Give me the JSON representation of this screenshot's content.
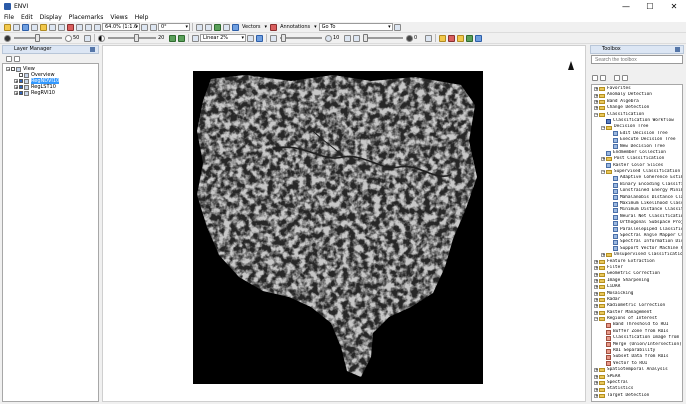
{
  "window": {
    "title": "ENVI",
    "minimize": "—",
    "maximize": "☐",
    "close": "✕"
  },
  "menu": [
    "File",
    "Edit",
    "Display",
    "Placemarks",
    "Views",
    "Help"
  ],
  "toolbar": {
    "zoom_value": "64.0% (1:1.6",
    "rotation_value": "0°",
    "vectors_label": "Vectors",
    "annotations_label": "Annotations",
    "goto_value": "Go To",
    "brightness_value": "50",
    "contrast_value": "20",
    "stretch_value": "Linear 2%",
    "sharpen_value": "10",
    "transparency_value": "0",
    "brightness_level": 0.5,
    "contrast_level": 0.6,
    "sharpen_level": 0.1,
    "transparency_level": 0.0
  },
  "layer_manager": {
    "title": "Layer Manager",
    "items": [
      {
        "label": "View",
        "depth": 0,
        "expander": "−",
        "checkbox": false,
        "selected": false
      },
      {
        "label": "Overview",
        "depth": 1,
        "expander": "",
        "checkbox": false,
        "selected": false
      },
      {
        "label": "RegNDVI10",
        "depth": 1,
        "expander": "+",
        "checkbox": true,
        "selected": true
      },
      {
        "label": "RegLST10",
        "depth": 1,
        "expander": "+",
        "checkbox": true,
        "selected": false
      },
      {
        "label": "RegRVI10",
        "depth": 1,
        "expander": "+",
        "checkbox": true,
        "selected": false
      }
    ]
  },
  "toolbox": {
    "title": "Toolbox",
    "search_placeholder": "Search the toolbox",
    "items": [
      {
        "label": "Favorites",
        "depth": 0,
        "type": "folder",
        "exp": "+"
      },
      {
        "label": "Anomaly Detection",
        "depth": 0,
        "type": "folder",
        "exp": "+"
      },
      {
        "label": "Band Algebra",
        "depth": 0,
        "type": "folder",
        "exp": "+"
      },
      {
        "label": "Change Detection",
        "depth": 0,
        "type": "folder",
        "exp": "+"
      },
      {
        "label": "Classification",
        "depth": 0,
        "type": "folder",
        "exp": "−"
      },
      {
        "label": "Classification Workflow",
        "depth": 1,
        "type": "pen",
        "exp": ""
      },
      {
        "label": "Decision Tree",
        "depth": 1,
        "type": "folder",
        "exp": "−"
      },
      {
        "label": "Edit Decision Tree",
        "depth": 2,
        "type": "tool",
        "exp": ""
      },
      {
        "label": "Execute Decision Tree",
        "depth": 2,
        "type": "tool",
        "exp": ""
      },
      {
        "label": "New Decision Tree",
        "depth": 2,
        "type": "tool",
        "exp": ""
      },
      {
        "label": "Endmember Collection",
        "depth": 1,
        "type": "tool",
        "exp": ""
      },
      {
        "label": "Post Classification",
        "depth": 1,
        "type": "folder",
        "exp": "+"
      },
      {
        "label": "Raster Color Slices",
        "depth": 1,
        "type": "tool",
        "exp": ""
      },
      {
        "label": "Supervised Classification",
        "depth": 1,
        "type": "folder",
        "exp": "−"
      },
      {
        "label": "Adaptive Coherence Estima",
        "depth": 2,
        "type": "tool",
        "exp": ""
      },
      {
        "label": "Binary Encoding Classific",
        "depth": 2,
        "type": "tool",
        "exp": ""
      },
      {
        "label": "Constrained Energy Minimi",
        "depth": 2,
        "type": "tool",
        "exp": ""
      },
      {
        "label": "Mahalanobis Distance Clas",
        "depth": 2,
        "type": "tool",
        "exp": ""
      },
      {
        "label": "Maximum Likelihood Classi",
        "depth": 2,
        "type": "tool",
        "exp": ""
      },
      {
        "label": "Minimum Distance Classifi",
        "depth": 2,
        "type": "tool",
        "exp": ""
      },
      {
        "label": "Neural Net Classification",
        "depth": 2,
        "type": "tool",
        "exp": ""
      },
      {
        "label": "Orthogonal Subspace Proje",
        "depth": 2,
        "type": "tool",
        "exp": ""
      },
      {
        "label": "Parallelepiped Classifica",
        "depth": 2,
        "type": "tool",
        "exp": ""
      },
      {
        "label": "Spectral Angle Mapper Cla",
        "depth": 2,
        "type": "tool",
        "exp": ""
      },
      {
        "label": "Spectral Information Dive",
        "depth": 2,
        "type": "tool",
        "exp": ""
      },
      {
        "label": "Support Vector Machine Cl",
        "depth": 2,
        "type": "tool",
        "exp": ""
      },
      {
        "label": "Unsupervised Classification",
        "depth": 1,
        "type": "folder",
        "exp": "+"
      },
      {
        "label": "Feature Extraction",
        "depth": 0,
        "type": "folder",
        "exp": "+"
      },
      {
        "label": "Filter",
        "depth": 0,
        "type": "folder",
        "exp": "+"
      },
      {
        "label": "Geometric Correction",
        "depth": 0,
        "type": "folder",
        "exp": "+"
      },
      {
        "label": "Image Sharpening",
        "depth": 0,
        "type": "folder",
        "exp": "+"
      },
      {
        "label": "LiDAR",
        "depth": 0,
        "type": "folder",
        "exp": "+"
      },
      {
        "label": "Mosaicking",
        "depth": 0,
        "type": "folder",
        "exp": "+"
      },
      {
        "label": "Radar",
        "depth": 0,
        "type": "folder",
        "exp": "+"
      },
      {
        "label": "Radiometric Correction",
        "depth": 0,
        "type": "folder",
        "exp": "+"
      },
      {
        "label": "Raster Management",
        "depth": 0,
        "type": "folder",
        "exp": "+"
      },
      {
        "label": "Regions of Interest",
        "depth": 0,
        "type": "folder",
        "exp": "−"
      },
      {
        "label": "Band Threshold to ROI",
        "depth": 1,
        "type": "red",
        "exp": ""
      },
      {
        "label": "Buffer Zone from ROIs",
        "depth": 1,
        "type": "red",
        "exp": ""
      },
      {
        "label": "Classification Image from RO",
        "depth": 1,
        "type": "red",
        "exp": ""
      },
      {
        "label": "Merge (Union/Intersection) R",
        "depth": 1,
        "type": "red",
        "exp": ""
      },
      {
        "label": "ROI Separability",
        "depth": 1,
        "type": "red",
        "exp": ""
      },
      {
        "label": "Subset Data from ROIs",
        "depth": 1,
        "type": "red",
        "exp": ""
      },
      {
        "label": "Vector to ROI",
        "depth": 1,
        "type": "red",
        "exp": ""
      },
      {
        "label": "Spatiotemporal Analysis",
        "depth": 0,
        "type": "folder",
        "exp": "+"
      },
      {
        "label": "SPEAR",
        "depth": 0,
        "type": "folder",
        "exp": "+"
      },
      {
        "label": "Spectral",
        "depth": 0,
        "type": "folder",
        "exp": "+"
      },
      {
        "label": "Statistics",
        "depth": 0,
        "type": "folder",
        "exp": "+"
      },
      {
        "label": "Target Detection",
        "depth": 0,
        "type": "folder",
        "exp": "+"
      }
    ]
  }
}
